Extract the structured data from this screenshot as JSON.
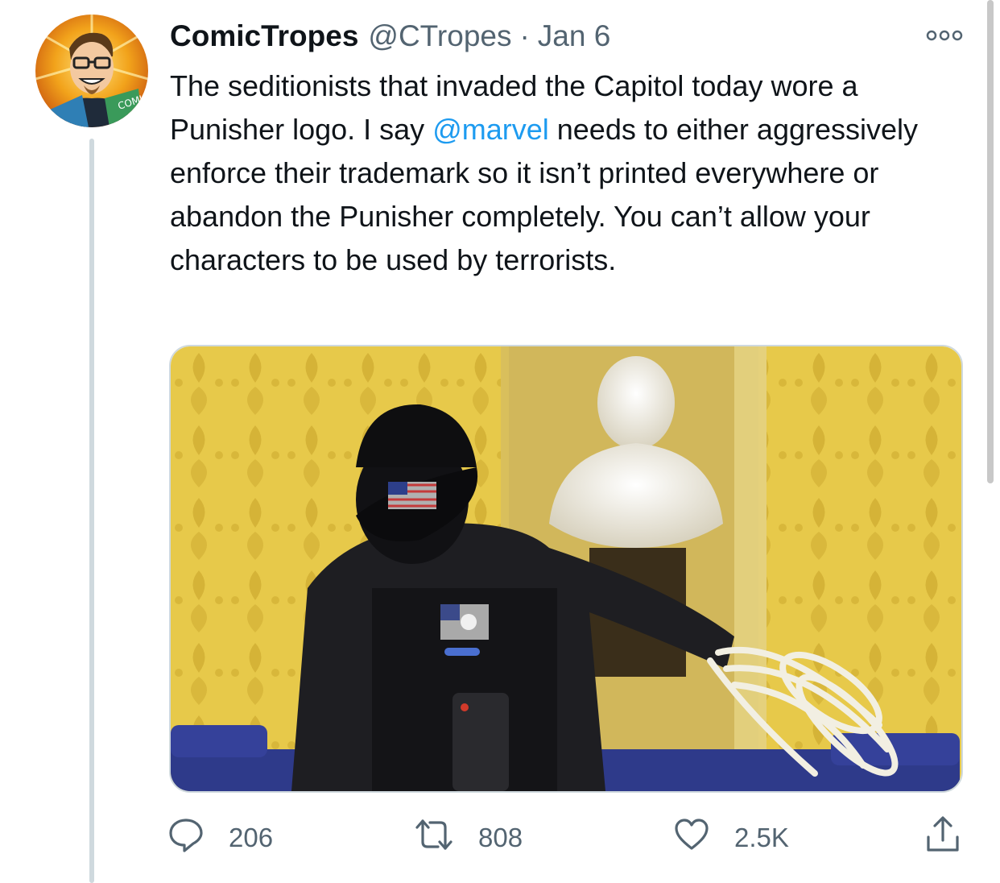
{
  "tweet": {
    "display_name": "ComicTropes",
    "handle": "@CTropes",
    "separator": "·",
    "date": "Jan 6",
    "text_before_mention": "The seditionists that invaded the Capitol today wore a Punisher logo. I say ",
    "mention": "@marvel",
    "text_after_mention": " needs to either aggressively enforce their trademark so it isn’t printed everywhere or abandon the Punisher completely. You can’t allow your characters to be used by terrorists.",
    "avatar_icon": "cartoon-avatar-icon",
    "media_icon": "photo-icon"
  },
  "actions": {
    "reply": {
      "icon": "reply-icon",
      "count": "206"
    },
    "retweet": {
      "icon": "retweet-icon",
      "count": "808"
    },
    "like": {
      "icon": "heart-icon",
      "count": "2.5K"
    },
    "share": {
      "icon": "share-icon"
    }
  },
  "more_icon": "more-icon",
  "colors": {
    "text": "#0f1419",
    "secondary": "#536471",
    "link": "#1d9bf0",
    "thread_line": "#cfd9de"
  }
}
